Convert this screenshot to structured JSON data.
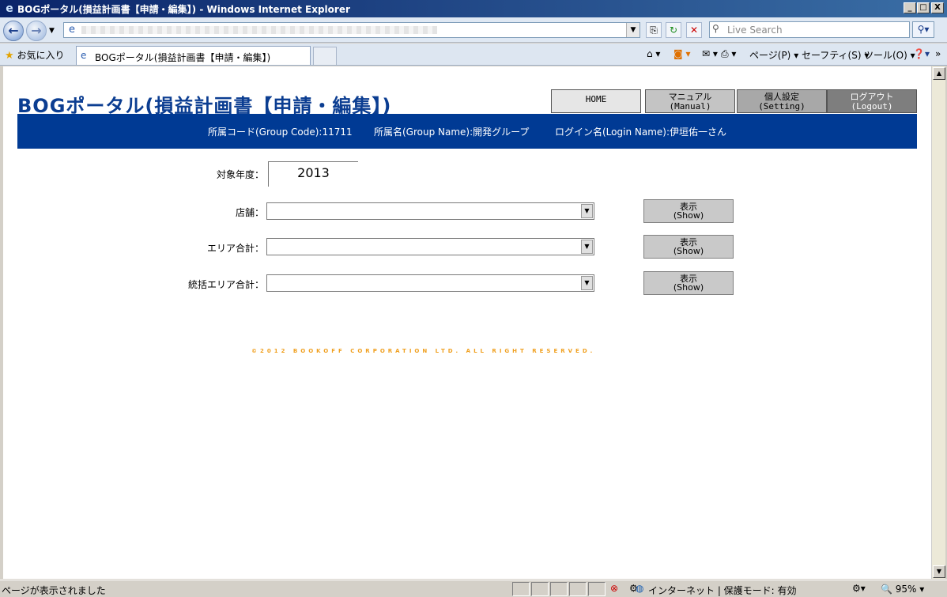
{
  "window": {
    "title": "BOGポータル(損益計画書【申請・編集】) - Windows Internet Explorer",
    "minimize": "_",
    "maximize": "□",
    "close": "X"
  },
  "toolbar": {
    "back": "←",
    "forward": "→",
    "search_placeholder": "Live Search"
  },
  "favorites": {
    "label": "お気に入り",
    "tab_title": "BOGポータル(損益計画書【申請・編集】)"
  },
  "commands": {
    "page": "ページ(P)",
    "safety": "セーフティ(S)",
    "tools": "ツール(O)"
  },
  "header": {
    "brand": "BOGポータル(損益計画書【申請・編集】)",
    "nav": [
      {
        "line1": "HOME",
        "line2": ""
      },
      {
        "line1": "マニュアル",
        "line2": "(Manual)"
      },
      {
        "line1": "個人設定",
        "line2": "(Setting)"
      },
      {
        "line1": "ログアウト",
        "line2": "(Logout)"
      }
    ]
  },
  "banner": {
    "group_code": "所属コード(Group Code):11711",
    "group_name": "所属名(Group Name):開発グループ",
    "login_name": "ログイン名(Login Name):伊垣佑一さん"
  },
  "form": {
    "year_label": "対象年度：",
    "year_value": "2013",
    "rows": [
      {
        "label": "店舗：",
        "button_line1": "表示",
        "button_line2": "(Show)"
      },
      {
        "label": "エリア合計：",
        "button_line1": "表示",
        "button_line2": "(Show)"
      },
      {
        "label": "統括エリア合計：",
        "button_line1": "表示",
        "button_line2": "(Show)"
      }
    ]
  },
  "footer": {
    "copyright": "©2012 BOOKOFF CORPORATION LTD. ALL RIGHT RESERVED."
  },
  "status": {
    "text": "ページが表示されました",
    "zone": "インターネット | 保護モード: 有効",
    "zoom": "95%"
  },
  "colors": {
    "brand": "#0b3d91",
    "banner": "#003a94",
    "copyright": "#f0a020"
  }
}
